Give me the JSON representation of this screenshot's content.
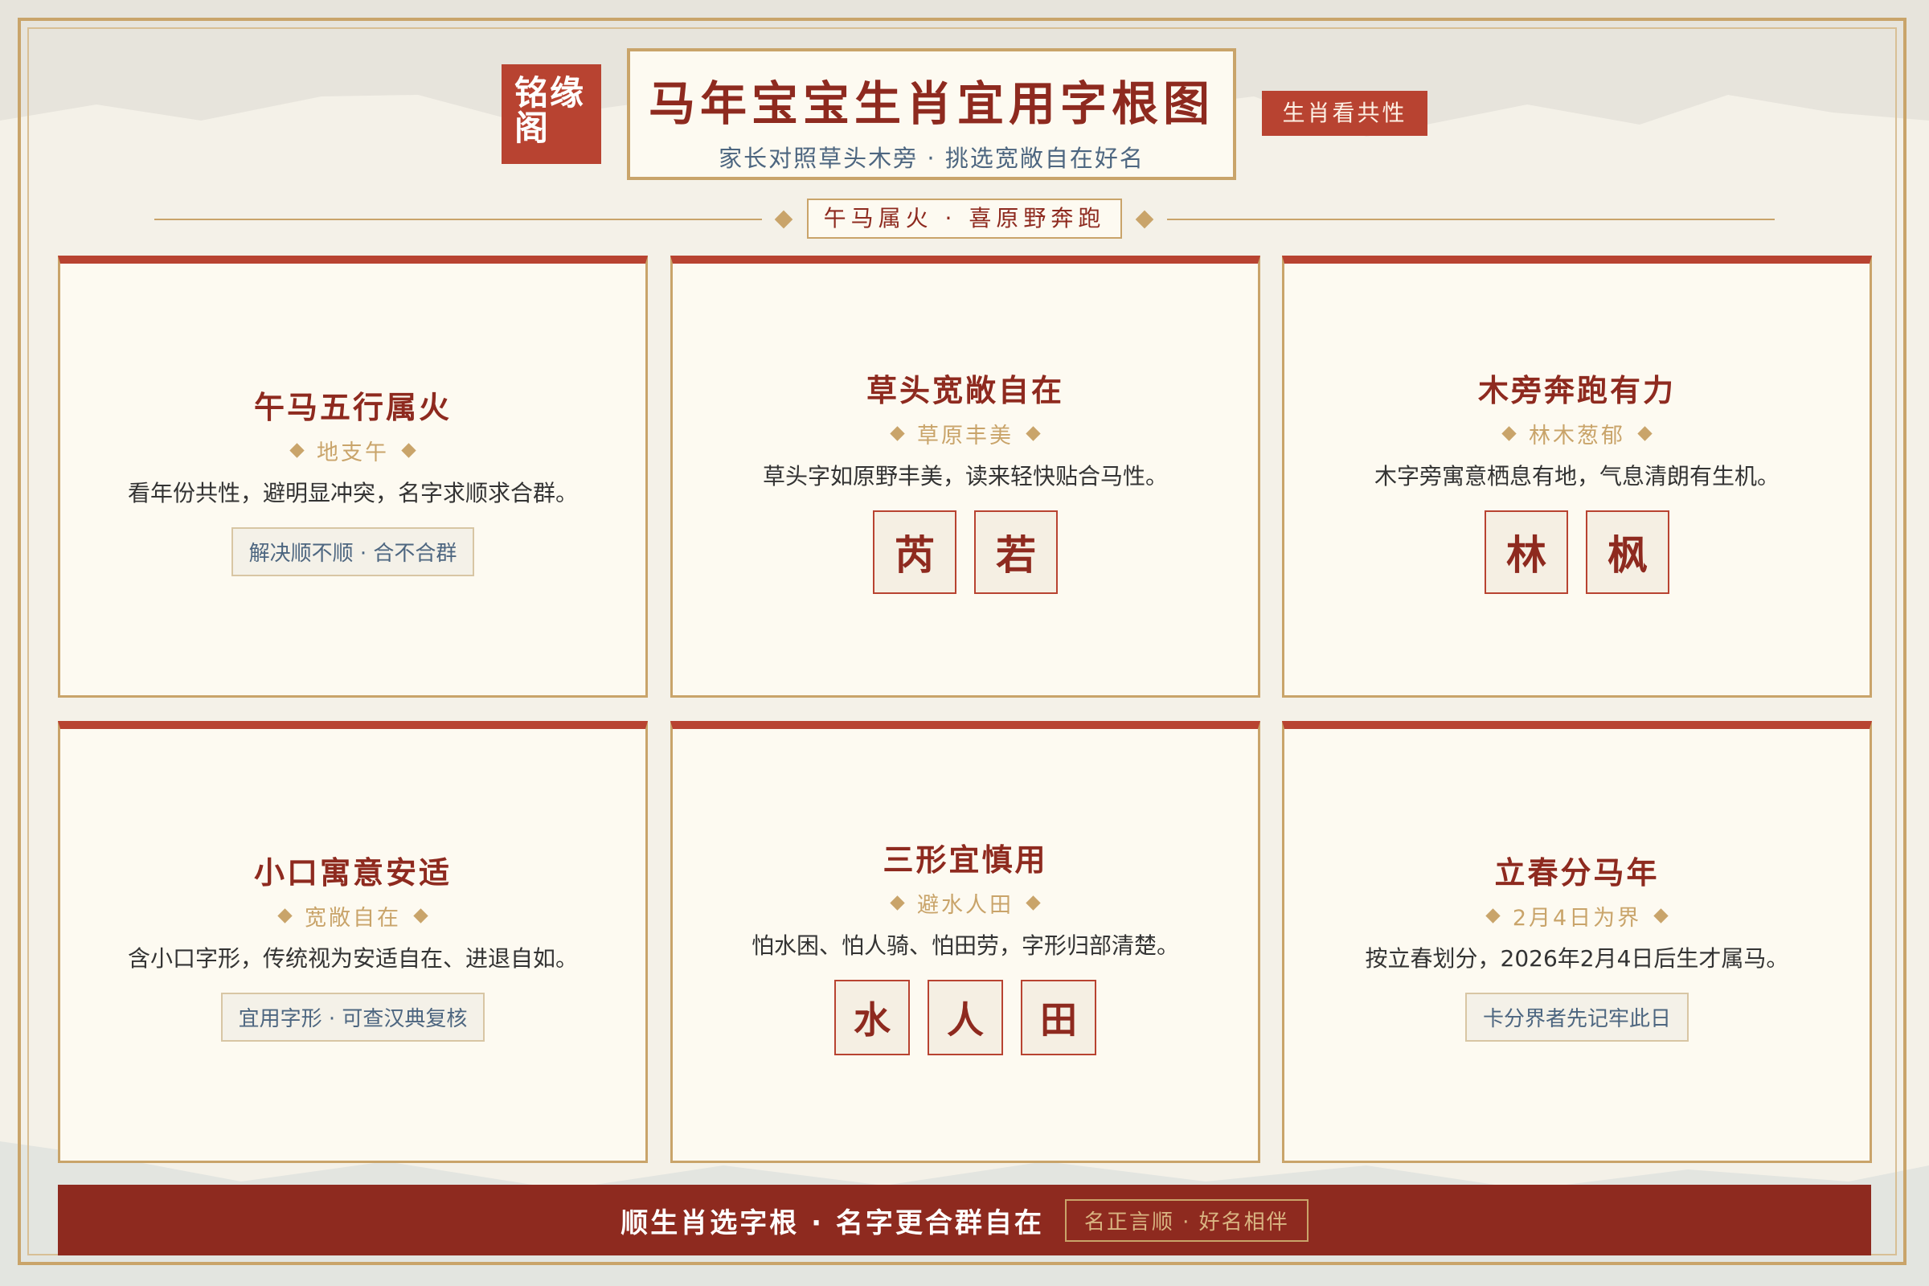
{
  "header": {
    "brand": "铭缘阁",
    "title": "马年宝宝生肖宜用字根图",
    "subtitle": "家长对照草头木旁 · 挑选宽敞自在好名",
    "tag": "生肖看共性",
    "banner": "午马属火 · 喜原野奔跑"
  },
  "cards": [
    {
      "title": "午马五行属火",
      "sub": "地支午",
      "desc": "看年份共性，避明显冲突，名字求顺求合群。",
      "note": "解决顺不顺 · 合不合群"
    },
    {
      "title": "草头宽敞自在",
      "sub": "草原丰美",
      "desc": "草头字如原野丰美，读来轻快贴合马性。",
      "glyphs": [
        "芮",
        "若"
      ]
    },
    {
      "title": "木旁奔跑有力",
      "sub": "林木葱郁",
      "desc": "木字旁寓意栖息有地，气息清朗有生机。",
      "glyphs": [
        "林",
        "枫"
      ]
    },
    {
      "title": "小口寓意安适",
      "sub": "宽敞自在",
      "desc": "含小口字形，传统视为安适自在、进退自如。",
      "note": "宜用字形 · 可查汉典复核"
    },
    {
      "title": "三形宜慎用",
      "sub": "避水人田",
      "desc": "怕水困、怕人骑、怕田劳，字形归部清楚。",
      "glyphs": [
        "水",
        "人",
        "田"
      ]
    },
    {
      "title": "立春分马年",
      "sub": "2月4日为界",
      "desc": "按立春划分，2026年2月4日后生才属马。",
      "note": "卡分界者先记牢此日"
    }
  ],
  "footer": {
    "main": "顺生肖选字根 · 名字更合群自在",
    "badge": "名正言顺 · 好名相伴"
  },
  "colors": {
    "accent_red": "#b84331",
    "deep_red": "#8e2a1f",
    "gold": "#c9a46a",
    "paper": "#fdfaf1",
    "ink_blue": "#4d6680"
  }
}
